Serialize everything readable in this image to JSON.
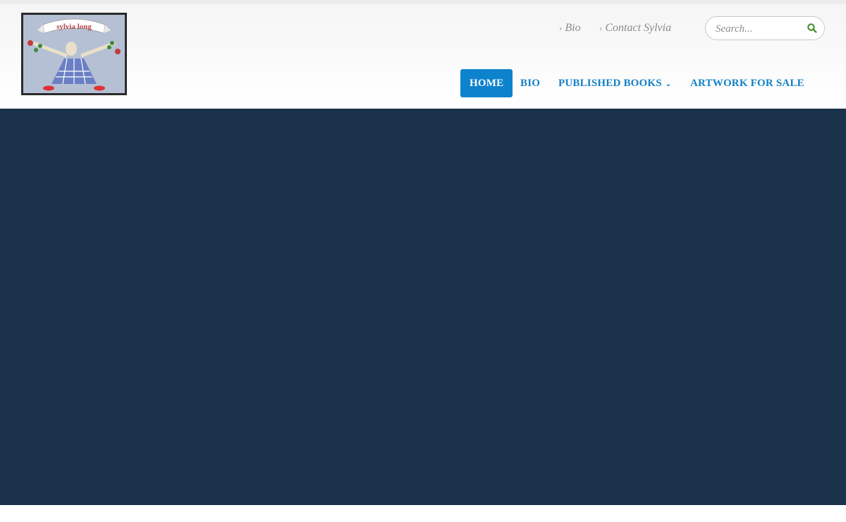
{
  "site": {
    "logo_text": "sylvia long"
  },
  "top_links": [
    {
      "label": "Bio"
    },
    {
      "label": "Contact Sylvia"
    }
  ],
  "search": {
    "placeholder": "Search..."
  },
  "nav": {
    "items": [
      {
        "label": "HOME",
        "active": true
      },
      {
        "label": "BIO"
      },
      {
        "label": "PUBLISHED BOOKS",
        "has_dropdown": true
      },
      {
        "label": "ARTWORK FOR SALE"
      }
    ]
  },
  "icons": {
    "link_chevron": "chevron-right-icon",
    "search": "search-icon",
    "dropdown": "chevron-down-icon"
  },
  "colors": {
    "accent": "#0e83cd",
    "nav_text": "#1480c6",
    "hero_bg": "#1a324a",
    "search_icon": "#3a8a1a"
  }
}
